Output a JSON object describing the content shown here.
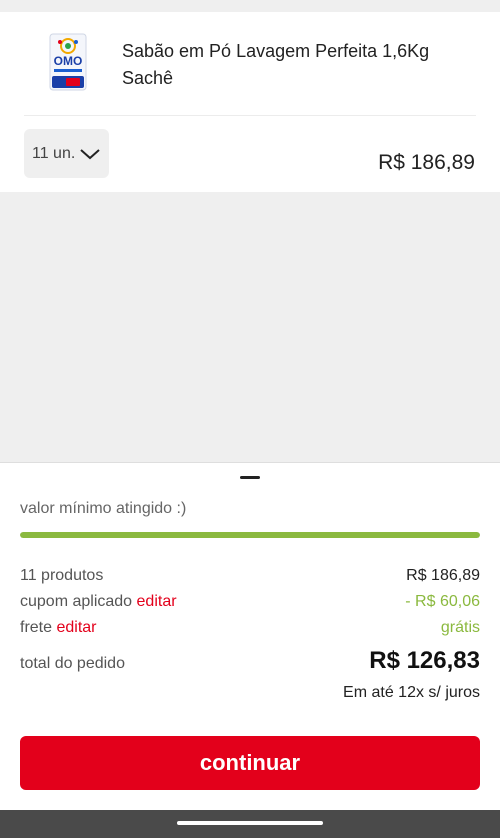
{
  "product": {
    "name": "Sabão em Pó Lavagem Perfeita 1,6Kg Sachê",
    "image_icon": "omo-detergent-package-icon",
    "brand_logo_text": "OMO",
    "quantity": "11 un.",
    "price": "R$ 186,89"
  },
  "summary": {
    "min_message": "valor mínimo atingido :)",
    "progress_fraction": 1.0,
    "products_label": "11 produtos",
    "products_value": "R$ 186,89",
    "coupon_label": "cupom aplicado",
    "coupon_edit": "editar",
    "coupon_value": "- R$ 60,06",
    "shipping_label": "frete",
    "shipping_edit": "editar",
    "shipping_value": "grátis",
    "total_label": "total do pedido",
    "total_value": "R$ 126,83",
    "installments": "Em até 12x s/ juros"
  },
  "actions": {
    "continue_label": "continuar"
  },
  "colors": {
    "accent_red": "#e3001b",
    "success_green": "#8bb93f"
  }
}
